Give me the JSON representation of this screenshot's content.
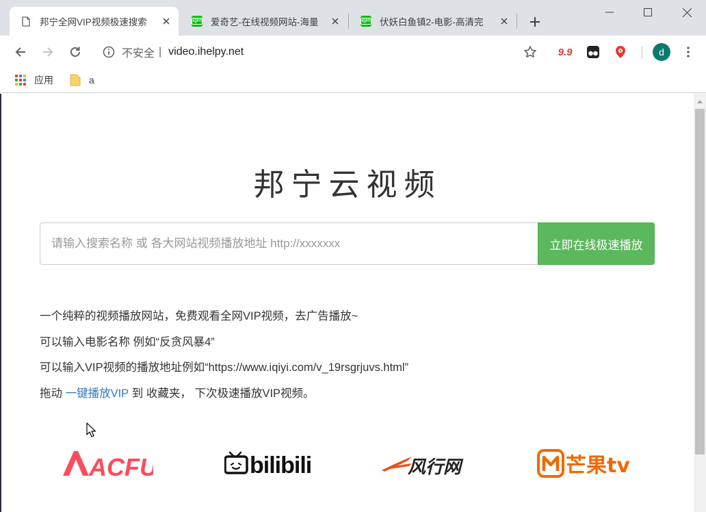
{
  "browser": {
    "tabs": [
      {
        "title": "邦宁全网VIP视频极速搜索",
        "favicon": "page-icon",
        "active": true
      },
      {
        "title": "爱奇艺-在线视频网站-海量",
        "favicon": "iqiyi-icon",
        "active": false
      },
      {
        "title": "伏妖白鱼镇2-电影-高清完",
        "favicon": "iqiyi-icon",
        "active": false
      }
    ],
    "favicon_text": "iQIYI",
    "address": {
      "security_label": "不安全",
      "separator": "|",
      "url": "video.ihelpy.net"
    },
    "extensions": [
      {
        "icon": "extension-99-icon",
        "text": "9.9",
        "color": "#e53935"
      },
      {
        "icon": "tampermonkey-icon"
      },
      {
        "icon": "location-pin-extension-icon",
        "color": "#e53935"
      }
    ],
    "profile_initial": "d",
    "bookmarks": [
      {
        "label": "应用",
        "icon": "apps-grid-icon"
      },
      {
        "label": "a",
        "icon": "folder-icon"
      }
    ]
  },
  "page": {
    "site_title": "邦宁云视频",
    "search": {
      "placeholder": "请输入搜索名称 或 各大网站视频播放地址 http://xxxxxxx",
      "value": "",
      "button_label": "立即在线极速播放"
    },
    "intro": {
      "line1": "一个纯粹的视频播放网站，免费观看全网VIP视频，去广告播放~",
      "line2": "可以输入电影名称 例如“反贪风暴4”",
      "line3": "可以输入VIP视频的播放地址例如“https://www.iqiyi.com/v_19rsgrjuvs.html”",
      "line4_prefix": "拖动",
      "line4_link": "一键播放VIP",
      "line4_suffix": "到 收藏夹， 下次极速播放VIP视频。"
    },
    "logos": [
      {
        "name": "acfun",
        "text": "ACFUN",
        "color": "#fd4c5b"
      },
      {
        "name": "bilibili",
        "text": "bilibili",
        "color": "#111111"
      },
      {
        "name": "fengxing",
        "text": "风行网",
        "color": "#222222",
        "accent": "#e8521b"
      },
      {
        "name": "mangotv",
        "text": "芒果tv",
        "color": "#ef6a00"
      }
    ]
  }
}
